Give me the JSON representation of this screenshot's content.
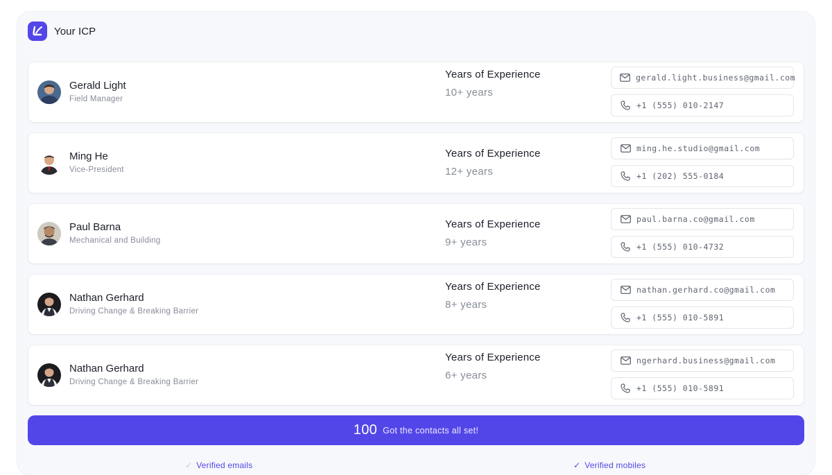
{
  "header": {
    "title": "Your ICP"
  },
  "experience_label": "Years of Experience",
  "contacts": [
    {
      "name": "Gerald Light",
      "role": "Field Manager",
      "experience": "10+ years",
      "email": "gerald.light.business@gmail.com",
      "phone": "+1 (555) 010-2147"
    },
    {
      "name": "Ming He",
      "role": "Vice-President",
      "experience": "12+ years",
      "email": "ming.he.studio@gmail.com",
      "phone": "+1 (202) 555-0184"
    },
    {
      "name": "Paul Barna",
      "role": "Mechanical and Building",
      "experience": "9+ years",
      "email": "paul.barna.co@gmail.com",
      "phone": "+1 (555) 010-4732"
    },
    {
      "name": "Nathan Gerhard",
      "role": "Driving Change & Breaking Barrier",
      "experience": "8+ years",
      "email": "nathan.gerhard.co@gmail.com",
      "phone": "+1 (555) 010-5891"
    },
    {
      "name": "Nathan Gerhard",
      "role": "Driving Change & Breaking Barrier",
      "experience": "6+ years",
      "email": "ngerhard.business@gmail.com",
      "phone": "+1 (555) 010-5891"
    }
  ],
  "cta": {
    "number": "100",
    "text": "Got the contacts all set!"
  },
  "footer": {
    "left": "Verified emails",
    "right": "Verified mobiles",
    "check": "✓"
  },
  "colors": {
    "accent": "#5346e8",
    "muted_text": "#878c98"
  },
  "icons": {
    "logo": "brand-logo-icon",
    "email": "mail-icon",
    "phone": "phone-icon",
    "check": "check-icon"
  }
}
